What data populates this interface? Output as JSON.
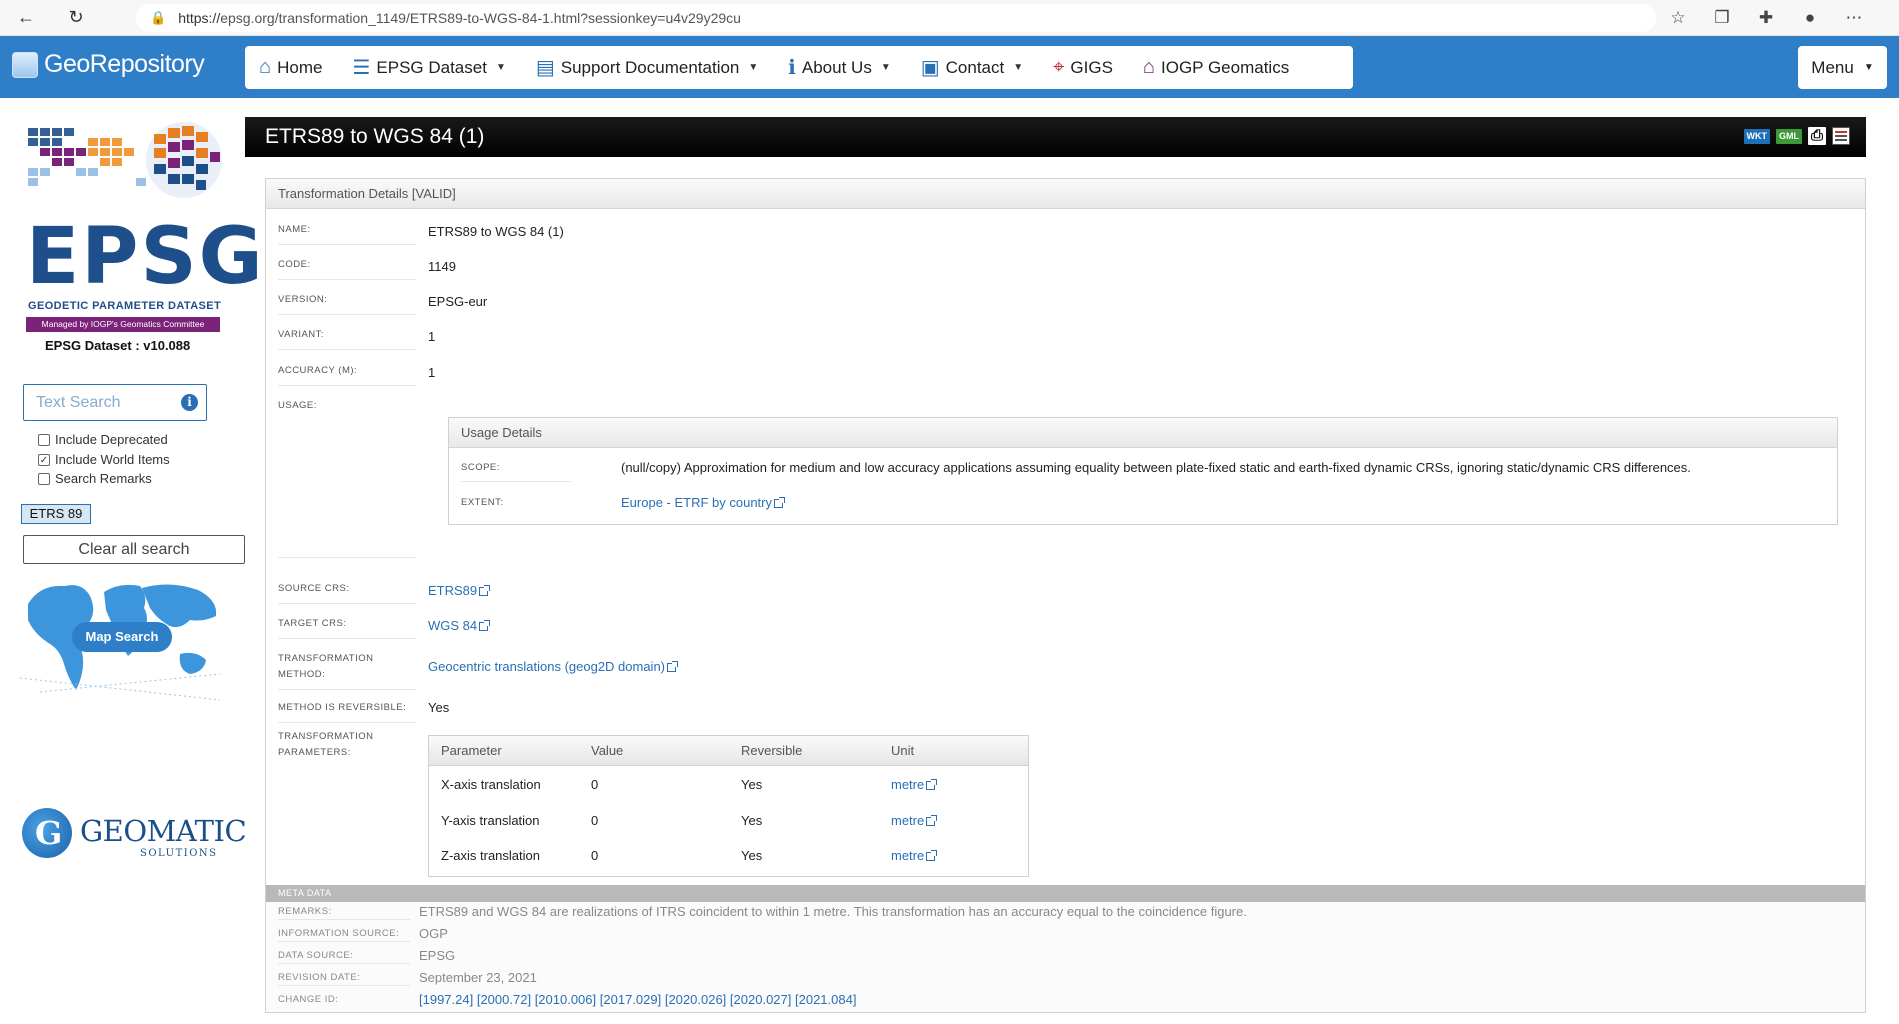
{
  "browser": {
    "url_scheme": "https://",
    "url_rest": "epsg.org/transformation_1149/ETRS89-to-WGS-84-1.html?sessionkey=u4v29y29cu"
  },
  "header": {
    "logo_text": "GeoRepository",
    "nav": [
      {
        "label": "Home",
        "icon": "home-icon",
        "has_caret": false
      },
      {
        "label": "EPSG Dataset",
        "icon": "database-icon",
        "has_caret": true
      },
      {
        "label": "Support Documentation",
        "icon": "server-icon",
        "has_caret": true
      },
      {
        "label": "About Us",
        "icon": "info-icon",
        "has_caret": true
      },
      {
        "label": "Contact",
        "icon": "contact-card-icon",
        "has_caret": true
      },
      {
        "label": "GIGS",
        "icon": "crosshair-icon",
        "has_caret": false
      },
      {
        "label": "IOGP Geomatics",
        "icon": "house-icon",
        "has_caret": false
      }
    ],
    "menu_label": "Menu"
  },
  "sidebar": {
    "epsg_word": "EPSG",
    "epsg_sub": "GEODETIC PARAMETER DATASET",
    "epsg_managed": "Managed by IOGP's Geomatics Committee",
    "dataset_version": "EPSG Dataset :  v10.088",
    "search_placeholder": "Text Search",
    "checkboxes": [
      {
        "label": "Include Deprecated",
        "checked": false
      },
      {
        "label": "Include World Items",
        "checked": true
      },
      {
        "label": "Search Remarks",
        "checked": false
      }
    ],
    "search_tag": "ETRS 89",
    "clear_label": "Clear all search",
    "map_search_label": "Map Search",
    "geomatic_word": "GEOMATIC",
    "geomatic_sub": "SOLUTIONS"
  },
  "content": {
    "title": "ETRS89 to WGS 84 (1)",
    "export_icons": [
      "WKT",
      "GML"
    ],
    "panel_title": "Transformation Details [VALID]",
    "fields": {
      "name": {
        "label": "NAME:",
        "value": "ETRS89 to WGS 84 (1)"
      },
      "code": {
        "label": "CODE:",
        "value": "1149"
      },
      "version": {
        "label": "VERSION:",
        "value": "EPSG-eur"
      },
      "variant": {
        "label": "VARIANT:",
        "value": "1"
      },
      "accuracy": {
        "label": "ACCURACY (M):",
        "value": "1"
      },
      "usage": {
        "label": "USAGE:"
      },
      "source_crs": {
        "label": "SOURCE CRS:",
        "value": "ETRS89"
      },
      "target_crs": {
        "label": "TARGET CRS:",
        "value": "WGS 84"
      },
      "method_l1": "TRANSFORMATION",
      "method_l2": "METHOD:",
      "method_value": "Geocentric translations (geog2D domain)",
      "reversible": {
        "label": "METHOD IS REVERSIBLE:",
        "value": "Yes"
      },
      "params_l1": "TRANSFORMATION",
      "params_l2": "PARAMETERS:"
    },
    "usage": {
      "title": "Usage Details",
      "scope_label": "SCOPE:",
      "scope_value": "(null/copy) Approximation for medium and low accuracy applications assuming equality between plate-fixed static and earth-fixed dynamic CRSs, ignoring static/dynamic CRS differences.",
      "extent_label": "EXTENT:",
      "extent_value": "Europe - ETRF by country"
    },
    "params": {
      "headers": [
        "Parameter",
        "Value",
        "Reversible",
        "Unit"
      ],
      "rows": [
        [
          "X-axis translation",
          "0",
          "Yes",
          "metre"
        ],
        [
          "Y-axis translation",
          "0",
          "Yes",
          "metre"
        ],
        [
          "Z-axis translation",
          "0",
          "Yes",
          "metre"
        ]
      ]
    },
    "meta": {
      "title": "META DATA",
      "remarks_label": "REMARKS:",
      "remarks_value": "ETRS89 and WGS 84 are realizations of ITRS coincident to within 1 metre. This transformation has an accuracy equal to the coincidence figure.",
      "info_source_label": "INFORMATION SOURCE:",
      "info_source_value": "OGP",
      "data_source_label": "DATA SOURCE:",
      "data_source_value": "EPSG",
      "revision_label": "REVISION DATE:",
      "revision_value": "September 23, 2021",
      "change_label": "CHANGE ID:",
      "change_ids": [
        "[1997.24]",
        "[2000.72]",
        "[2010.006]",
        "[2017.029]",
        "[2020.026]",
        "[2020.027]",
        "[2021.084]"
      ]
    }
  }
}
